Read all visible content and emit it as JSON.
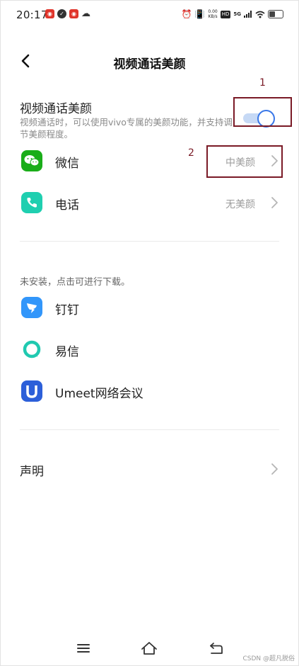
{
  "status_bar": {
    "time": "20:17",
    "net_speed_value": "0.00",
    "net_speed_unit": "KB/s",
    "hd_label": "HD",
    "signal_label": "5G",
    "notification_icons": [
      "netease-music-icon",
      "checkmark-app-icon",
      "netease-music-icon",
      "cloud-app-icon"
    ],
    "system_icons": [
      "alarm-icon",
      "vibrate-icon",
      "wifi-icon",
      "battery-icon"
    ]
  },
  "header": {
    "title": "视频通话美颜",
    "back_icon": "chevron-left-icon"
  },
  "beauty_toggle": {
    "title": "视频通话美颜",
    "description": "视频通话时，可以使用vivo专属的美颜功能，并支持调节美颜程度。",
    "enabled": true,
    "accent_color": "#3a78e8",
    "track_color": "#c6d9f5"
  },
  "installed_apps": [
    {
      "name": "微信",
      "value": "中美颜",
      "icon": "wechat-icon",
      "color": "#1aad19"
    },
    {
      "name": "电话",
      "value": "无美颜",
      "icon": "phone-icon",
      "color": "#1fcfb0"
    }
  ],
  "uninstalled_section": {
    "note": "未安装，点击可进行下载。",
    "apps": [
      {
        "name": "钉钉",
        "icon": "dingtalk-icon",
        "color": "#3296fa"
      },
      {
        "name": "易信",
        "icon": "yixin-icon",
        "color": "#20c9b0"
      },
      {
        "name": "Umeet网络会议",
        "icon": "umeet-icon",
        "color": "#2c5fd9"
      }
    ]
  },
  "statement": {
    "label": "声明"
  },
  "annotations": {
    "box1_number": "1",
    "box2_number": "2",
    "color": "#7a1a26"
  },
  "nav_bar": {
    "icons": [
      "menu-icon",
      "home-icon",
      "back-icon"
    ]
  },
  "watermark": "CSDN @超凡脱俗"
}
